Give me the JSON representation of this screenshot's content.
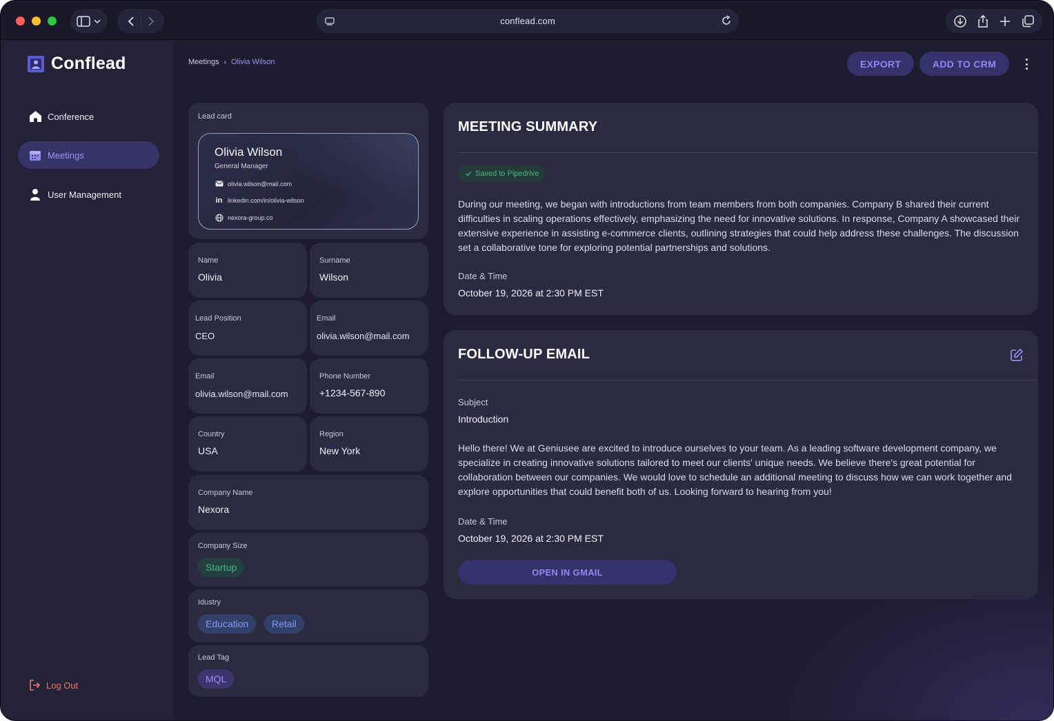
{
  "browser": {
    "url": "conflead.com"
  },
  "app": {
    "name": "Conflead",
    "nav": [
      {
        "label": "Conference",
        "icon": "home-icon"
      },
      {
        "label": "Meetings",
        "icon": "calendar-icon"
      },
      {
        "label": "User Management",
        "icon": "user-icon"
      }
    ],
    "logout_label": "Log Out"
  },
  "breadcrumb": {
    "root": "Meetings",
    "current": "Olivia Wilson"
  },
  "toolbar": {
    "export_label": "EXPORT",
    "crm_label": "ADD TO CRM"
  },
  "lead_card": {
    "label": "Lead card",
    "name": "Olivia Wilson",
    "role": "General Manager",
    "email": "olivia.wilson@mail.com",
    "linkedin": "linkedin.com/in/olivia-wilson",
    "website": "nexora-group.co"
  },
  "fields": {
    "name": {
      "label": "Name",
      "value": "Olivia"
    },
    "surname": {
      "label": "Surname",
      "value": "Wilson"
    },
    "position": {
      "label": "Lead Position",
      "value": "CEO"
    },
    "email1": {
      "label": "Email",
      "value": "olivia.wilson@mail.com"
    },
    "email2": {
      "label": "Email",
      "value": "olivia.wilson@mail.com"
    },
    "phone": {
      "label": "Phone Number",
      "value": "+1234-567-890"
    },
    "country": {
      "label": "Country",
      "value": "USA"
    },
    "region": {
      "label": "Region",
      "value": "New York"
    },
    "company": {
      "label": "Company Name",
      "value": "Nexora"
    },
    "company_size": {
      "label": "Company Size",
      "tag": "Startup"
    },
    "industry": {
      "label": "Idustry",
      "tags": [
        "Education",
        "Retail"
      ]
    },
    "lead_tag": {
      "label": "Lead Tag",
      "tag": "MQL"
    }
  },
  "summary": {
    "title": "MEETING SUMMARY",
    "badge": "Saved to Pipedrive",
    "text": "During our meeting, we began with introductions from team members from both companies. Company B shared their current difficulties in scaling operations effectively, emphasizing the need for innovative solutions. In response, Company A showcased their extensive experience in assisting e-commerce clients, outlining strategies that could help address these challenges. The discussion set a collaborative tone for exploring potential partnerships and solutions.",
    "datetime_label": "Date & Time",
    "datetime": "October 19, 2026 at 2:30 PM EST"
  },
  "followup": {
    "title": "FOLLOW-UP EMAIL",
    "subject_label": "Subject",
    "subject": "Introduction",
    "body": "Hello there! We at Geniusee are excited to introduce ourselves to your team. As a leading software development company, we specialize in creating innovative solutions tailored to meet our clients' unique needs. We believe there's great potential for collaboration between our companies. We would love to schedule an additional meeting to discuss how we can work together and explore opportunities that could benefit both of us. Looking forward to hearing from you!",
    "datetime_label": "Date & Time",
    "datetime": "October 19, 2026 at 2:30 PM EST",
    "gmail_label": "OPEN IN GMAIL"
  },
  "colors": {
    "accent": "#8f8af0",
    "accent_bg": "#33326a",
    "success": "#3fb887",
    "danger": "#e97a6d",
    "card_bg": "#2a2a40",
    "page_bg": "#1e1d30"
  }
}
